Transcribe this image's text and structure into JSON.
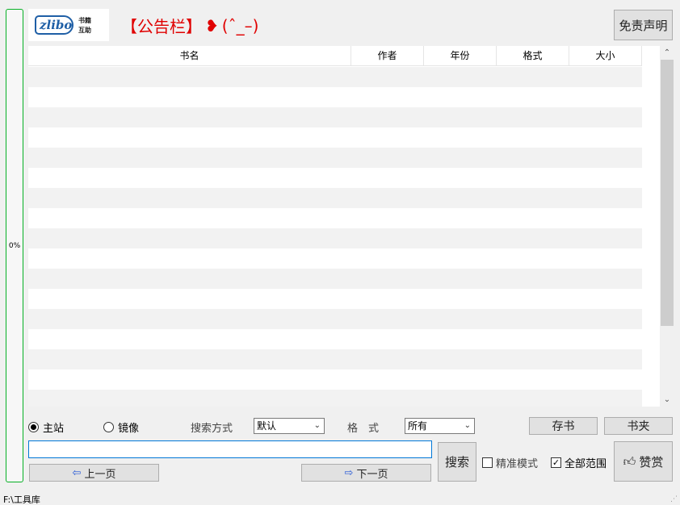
{
  "progress": {
    "label": "0%",
    "value": 0
  },
  "logo": {
    "brand": "zlibo",
    "line1": "书籍",
    "line2": "互助"
  },
  "notice": {
    "text": "【公告栏】",
    "emoticon": "(ˆ_–)"
  },
  "buttons": {
    "disclaimer": "免责声明",
    "save_book": "存书",
    "bookshelf": "书夹",
    "search": "搜索",
    "prev_page": "上一页",
    "next_page": "下一页",
    "reward": "赞赏"
  },
  "table": {
    "columns": [
      "书名",
      "作者",
      "年份",
      "格式",
      "大小"
    ],
    "rows": []
  },
  "source": {
    "main_label": "主站",
    "mirror_label": "镜像",
    "selected": "主站"
  },
  "search_mode": {
    "label": "搜索方式",
    "value": "默认"
  },
  "format": {
    "label": "格　式",
    "value": "所有"
  },
  "search_input": {
    "value": ""
  },
  "options": {
    "precise_label": "精准模式",
    "precise_checked": false,
    "full_range_label": "全部范围",
    "full_range_checked": true
  },
  "status_bar": {
    "path": "F:\\工具库"
  },
  "colors": {
    "accent": "#0078d7",
    "notice": "#e00000",
    "progress_border": "#06b025"
  }
}
